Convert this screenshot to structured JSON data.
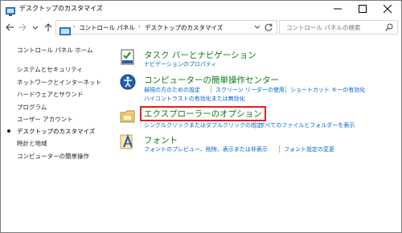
{
  "window": {
    "title": "デスクトップのカスタマイズ"
  },
  "nav": {
    "breadcrumbs": [
      "コントロール パネル",
      "デスクトップのカスタマイズ"
    ],
    "search_placeholder": "コントロール パネルの検索"
  },
  "sidebar": {
    "home": "コントロール パネル ホーム",
    "items": [
      {
        "label": "システムとセキュリティ",
        "active": false
      },
      {
        "label": "ネットワークとインターネット",
        "active": false
      },
      {
        "label": "ハードウェアとサウンド",
        "active": false
      },
      {
        "label": "プログラム",
        "active": false
      },
      {
        "label": "ユーザー アカウント",
        "active": false
      },
      {
        "label": "デスクトップのカスタマイズ",
        "active": true
      },
      {
        "label": "時計と地域",
        "active": false
      },
      {
        "label": "コンピューターの簡単操作",
        "active": false
      }
    ]
  },
  "categories": [
    {
      "title": "タスク バーとナビゲーション",
      "links": [
        "ナビゲーションのプロパティ"
      ]
    },
    {
      "title": "コンピューターの簡単操作センター",
      "links": [
        "弱視の方のための設定",
        "スクリーン リーダーの使用",
        "ショートカット キーの有効化",
        "ハイコントラストの有効化または無効化"
      ]
    },
    {
      "title": "エクスプローラーのオプション",
      "highlighted": true,
      "links": [
        "シングルクリックまたはダブルクリックの指定",
        "すべてのファイルとフォルダーを表示"
      ]
    },
    {
      "title": "フォント",
      "links": [
        "フォントのプレビュー、削除、表示または非表示",
        "フォント設定の変更"
      ]
    }
  ],
  "colors": {
    "category_title": "#0e7a17",
    "link": "#0066cc",
    "highlight_box": "#e02020"
  }
}
